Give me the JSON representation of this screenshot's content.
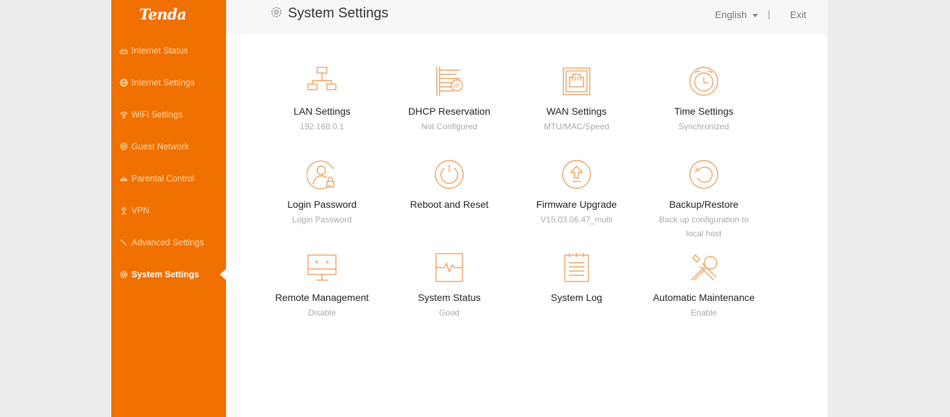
{
  "brand": {
    "logo_text": "Tenda",
    "accent": "#f07000",
    "icon_color": "#f0a060"
  },
  "sidebar": {
    "items": [
      {
        "label": "Internet Status",
        "icon": "router-icon"
      },
      {
        "label": "Internet Settings",
        "icon": "globe-icon"
      },
      {
        "label": "WiFi Settings",
        "icon": "wifi-icon"
      },
      {
        "label": "Guest Network",
        "icon": "guest-icon"
      },
      {
        "label": "Parental Control",
        "icon": "parental-icon"
      },
      {
        "label": "VPN",
        "icon": "vpn-icon"
      },
      {
        "label": "Advanced Settings",
        "icon": "wrench-icon"
      },
      {
        "label": "System Settings",
        "icon": "gear-icon",
        "active": true
      }
    ]
  },
  "header": {
    "title": "System Settings",
    "language": "English",
    "separator": "|",
    "exit_label": "Exit"
  },
  "tiles": [
    {
      "name": "LAN Settings",
      "sub": "192.168.0.1",
      "icon": "lan-topology-icon"
    },
    {
      "name": "DHCP Reservation",
      "sub": "Not Configured",
      "icon": "dhcp-ip-icon"
    },
    {
      "name": "WAN Settings",
      "sub": "MTU/MAC/Speed",
      "icon": "ethernet-port-icon"
    },
    {
      "name": "Time Settings",
      "sub": "Synchronized",
      "icon": "alarm-clock-icon"
    },
    {
      "name": "Login Password",
      "sub": "Login Password",
      "icon": "user-lock-icon"
    },
    {
      "name": "Reboot and Reset",
      "sub": "",
      "icon": "power-icon"
    },
    {
      "name": "Firmware Upgrade",
      "sub": "V15.03.06.47_multi",
      "icon": "upgrade-arrow-icon"
    },
    {
      "name": "Backup/Restore",
      "sub": "Back up configuration to local host",
      "icon": "restore-icon"
    },
    {
      "name": "Remote Management",
      "sub": "Disable",
      "icon": "monitor-code-icon"
    },
    {
      "name": "System Status",
      "sub": "Good",
      "icon": "pulse-icon"
    },
    {
      "name": "System Log",
      "sub": "",
      "icon": "notepad-icon"
    },
    {
      "name": "Automatic Maintenance",
      "sub": "Enable",
      "icon": "tools-icon"
    }
  ]
}
